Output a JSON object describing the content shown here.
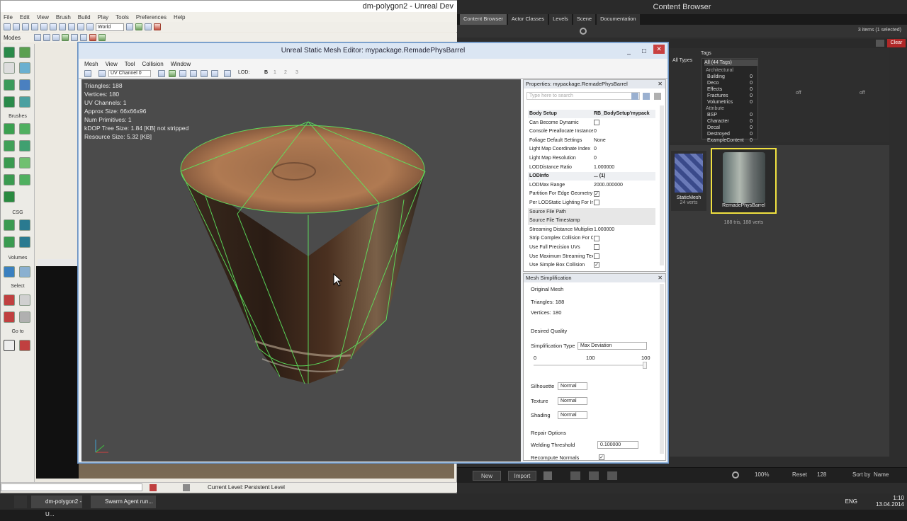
{
  "editor": {
    "title": "dm-polygon2 - Unreal Dev",
    "menu": [
      "File",
      "Edit",
      "View",
      "Brush",
      "Build",
      "Play",
      "Tools",
      "Preferences",
      "Help"
    ],
    "world_dropdown": "World",
    "modes_label": "Modes",
    "toolbox_sections": {
      "brushes": "Brushes",
      "csg": "CSG",
      "volumes": "Volumes",
      "select": "Select",
      "goto": "Go to"
    },
    "status": {
      "label": "Current Level:",
      "value": "Persistent Level"
    }
  },
  "content_browser": {
    "title": "Content Browser",
    "tabs": [
      "Content Browser",
      "Actor Classes",
      "Levels",
      "Scene",
      "Documentation"
    ],
    "selected_count": "3 items (1 selected)",
    "clear_label": "Clear",
    "type_filter": "All Types",
    "tags_header": "Tags",
    "all_tags": "All (44 Tags)",
    "tag_groups": [
      {
        "name": "Architectural",
        "items": [
          {
            "n": "Building",
            "c": "0"
          },
          {
            "n": "Deco",
            "c": "0"
          },
          {
            "n": "Effects",
            "c": "0"
          },
          {
            "n": "Fractures",
            "c": "0"
          },
          {
            "n": "Volumetrics",
            "c": "0"
          }
        ]
      },
      {
        "name": "Attribute",
        "items": [
          {
            "n": "BSP",
            "c": "0"
          },
          {
            "n": "Character",
            "c": "0"
          },
          {
            "n": "Decal",
            "c": "0"
          },
          {
            "n": "Destroyed",
            "c": "0"
          },
          {
            "n": "ExampleContent",
            "c": "0"
          }
        ]
      }
    ],
    "off_labels": [
      "off",
      "off"
    ],
    "assets": [
      {
        "name": "StaticMesh",
        "meta": "24 verts"
      },
      {
        "name": "RemadePhysBarrel",
        "meta": "188 tris, 188 verts"
      }
    ],
    "bottom": {
      "new": "New",
      "import": "Import",
      "zoom": "100%",
      "reset": "Reset",
      "size": "128",
      "sort": "Sort by",
      "sort_value": "Name"
    }
  },
  "mesh_editor": {
    "title": "Unreal Static Mesh Editor: mypackage.RemadePhysBarrel",
    "menu": [
      "Mesh",
      "View",
      "Tool",
      "Collision",
      "Window"
    ],
    "uv_channel": "UV Channel 0",
    "lod_label": "LOD:",
    "lod_values": [
      "B",
      "1",
      "2",
      "3"
    ],
    "stats": [
      "Triangles:  188",
      "Vertices:  180",
      "UV Channels:  1",
      "Approx Size: 66x66x96",
      "Num Primitives:  1",
      "kDOP Tree Size: 1.84 [KB] not stripped",
      "Resource Size: 5.32 [KB]"
    ],
    "properties": {
      "header": "Properties: mypackage.RemadePhysBarrel",
      "search_placeholder": "Type here to search",
      "rows": [
        {
          "k": "Body Setup",
          "v": "RB_BodySetup'mypack",
          "type": "cat"
        },
        {
          "k": "Can Become Dynamic",
          "v": "",
          "type": "chk",
          "checked": false
        },
        {
          "k": "Console Preallocate Instance",
          "v": "0",
          "type": "val"
        },
        {
          "k": "Foliage Default Settings",
          "v": "None",
          "type": "val"
        },
        {
          "k": "Light Map Coordinate Index",
          "v": "0",
          "type": "val"
        },
        {
          "k": "Light Map Resolution",
          "v": "0",
          "type": "val"
        },
        {
          "k": "LODDistance Ratio",
          "v": "1.000000",
          "type": "val"
        },
        {
          "k": "LODInfo",
          "v": "... (1)",
          "type": "cat"
        },
        {
          "k": "LODMax Range",
          "v": "2000.000000",
          "type": "val"
        },
        {
          "k": "Partition For Edge Geometry",
          "v": "",
          "type": "chk",
          "checked": true
        },
        {
          "k": "Per LODStatic Lighting For Instancing",
          "v": "",
          "type": "chk",
          "checked": false
        },
        {
          "k": "Source File Path",
          "v": "",
          "type": "sel"
        },
        {
          "k": "Source File Timestamp",
          "v": "",
          "type": "sel"
        },
        {
          "k": "Streaming Distance Multiplier",
          "v": "1.000000",
          "type": "val"
        },
        {
          "k": "Strip Complex Collision For Console",
          "v": "",
          "type": "chk",
          "checked": false
        },
        {
          "k": "Use Full Precision UVs",
          "v": "",
          "type": "chk",
          "checked": false
        },
        {
          "k": "Use Maximum Streaming Texel Ratio",
          "v": "",
          "type": "chk",
          "checked": false
        },
        {
          "k": "Use Simple Box Collision",
          "v": "",
          "type": "chk",
          "checked": true
        }
      ]
    },
    "simplification": {
      "header": "Mesh Simplification",
      "original_mesh": "Original Mesh",
      "triangles": "Triangles:  188",
      "vertices": "Vertices:  180",
      "desired_quality": "Desired Quality",
      "simplification_type_label": "Simplification Type",
      "simplification_type": "Max Deviation",
      "slider_min": "0",
      "slider_mid": "100",
      "slider_max": "100",
      "slider_value": 1.0,
      "silhouette_label": "Silhouette",
      "silhouette": "Normal",
      "texture_label": "Texture",
      "texture": "Normal",
      "shading_label": "Shading",
      "shading": "Normal",
      "repair_options": "Repair Options",
      "welding_label": "Welding Threshold",
      "welding_value": "0.100000",
      "recompute_label": "Recompute Normals",
      "recompute_checked": true
    }
  },
  "taskbar": {
    "items": [
      "dm-polygon2 - U...",
      "Swarm Agent run..."
    ],
    "lang": "ENG",
    "time": "1:10",
    "date": "13.04.2014"
  },
  "colors": {
    "wire": "#5ee65e",
    "selection": "#f0e040",
    "title_blue": "#dbe6f3",
    "close_red": "#c84040"
  }
}
